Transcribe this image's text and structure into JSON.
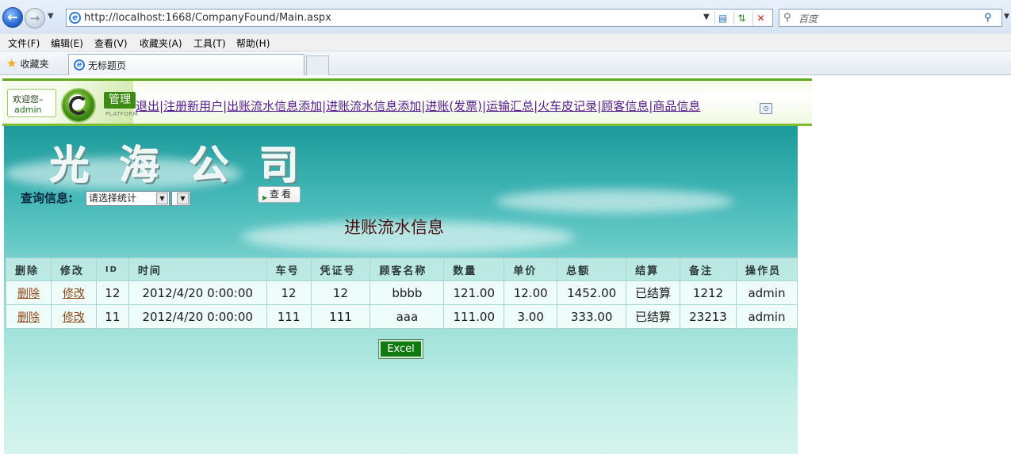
{
  "browser": {
    "url": "http://localhost:1668/CompanyFound/Main.aspx",
    "search_placeholder": "百度",
    "menu": [
      "文件(F)",
      "编辑(E)",
      "查看(V)",
      "收藏夹(A)",
      "工具(T)",
      "帮助(H)"
    ],
    "favorites_label": "收藏夹",
    "tab_title": "无标题页"
  },
  "header": {
    "welcome": "欢迎您–",
    "user": "admin",
    "badge": "管理",
    "platform": "PLATFORM",
    "links": [
      "退出",
      "注册新用户",
      "出账流水信息添加",
      "进账流水信息添加",
      "进账(发票)",
      "运输汇总",
      "火车皮记录",
      "顾客信息",
      "商品信息"
    ]
  },
  "banner": {
    "title": "光海公司"
  },
  "query": {
    "label": "查询信息:",
    "select_value": "请选择统计",
    "view_button": "查看"
  },
  "page_heading": "进账流水信息",
  "table": {
    "columns": [
      "删除",
      "修改",
      "ID",
      "时间",
      "车号",
      "凭证号",
      "顾客名称",
      "数量",
      "单价",
      "总额",
      "结算",
      "备注",
      "操作员"
    ],
    "rows": [
      [
        "删除",
        "修改",
        "12",
        "2012/4/20 0:00:00",
        "12",
        "12",
        "bbbb",
        "121.00",
        "12.00",
        "1452.00",
        "已结算",
        "1212",
        "admin"
      ],
      [
        "删除",
        "修改",
        "11",
        "2012/4/20 0:00:00",
        "111",
        "111",
        "aaa",
        "111.00",
        "3.00",
        "333.00",
        "已结算",
        "23213",
        "admin"
      ]
    ]
  },
  "excel_button": "Excel"
}
